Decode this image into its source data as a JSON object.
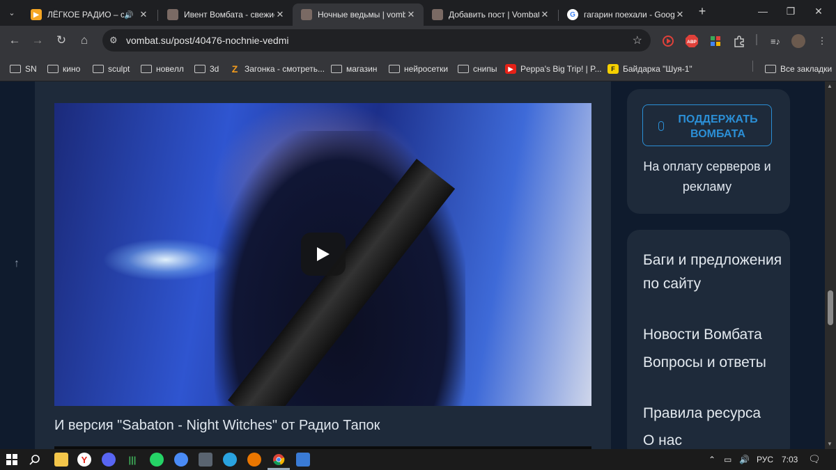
{
  "browser": {
    "tabs": [
      {
        "title": "ЛЁГКОЕ РАДИО – сл",
        "favicon": "play-triangle-orange",
        "audio": true,
        "active": false
      },
      {
        "title": "Ивент Вомбата - свежие",
        "favicon": "wombat",
        "active": false
      },
      {
        "title": "Ночные ведьмы | vombat",
        "favicon": "wombat",
        "active": true
      },
      {
        "title": "Добавить пост | Vombat",
        "favicon": "wombat",
        "active": false
      },
      {
        "title": "гагарин поехали - Goog",
        "favicon": "google-g",
        "active": false
      }
    ],
    "url": "vombat.su/post/40476-nochnie-vedmi",
    "extensions": [
      {
        "name": "record-icon",
        "color": "#e0413a"
      },
      {
        "name": "adblock-icon",
        "label": "ABP",
        "color": "#e0413a"
      },
      {
        "name": "puzzle-color-icon",
        "color": "#3aa858"
      },
      {
        "name": "extensions-icon",
        "color": "#c8c8c8"
      }
    ],
    "bookmarks": [
      {
        "label": "SN",
        "type": "folder"
      },
      {
        "label": "кино",
        "type": "folder"
      },
      {
        "label": "sculpt",
        "type": "folder"
      },
      {
        "label": "новелл",
        "type": "folder"
      },
      {
        "label": "3d",
        "type": "folder"
      },
      {
        "label": "Загонка - смотреть...",
        "type": "link",
        "icon": "Z",
        "color": "#f29b1d"
      },
      {
        "label": "магазин",
        "type": "folder"
      },
      {
        "label": "нейросетки",
        "type": "folder"
      },
      {
        "label": "снипы",
        "type": "folder"
      },
      {
        "label": "Peppa's Big Trip! | P...",
        "type": "link",
        "icon": "▶",
        "color": "#e62117"
      },
      {
        "label": "Байдарка \"Шуя-1\"",
        "type": "link",
        "icon": "F",
        "color": "#f5d000"
      }
    ],
    "all_bookmarks": "Все закладки"
  },
  "page": {
    "video": {
      "state": "paused"
    },
    "caption": "И версия \"Sabaton - Night Witches\" от Радио Тапок",
    "sidebar": {
      "support_button": "ПОДДЕРЖАТЬ ВОМБАТА",
      "support_text": "На оплату серверов и рекламу",
      "links": [
        "Баги и предложения по сайту",
        "Новости Вомбата",
        "Вопросы и ответы",
        "Правила ресурса",
        "О нас"
      ]
    }
  },
  "taskbar": {
    "apps": [
      {
        "name": "windows-start-icon"
      },
      {
        "name": "search-icon"
      },
      {
        "name": "file-explorer-icon"
      },
      {
        "name": "yandex-browser-icon"
      },
      {
        "name": "discord-icon"
      },
      {
        "name": "app-green-icon"
      },
      {
        "name": "whatsapp-icon"
      },
      {
        "name": "chromium-icon"
      },
      {
        "name": "calculator-icon"
      },
      {
        "name": "telegram-icon"
      },
      {
        "name": "blender-icon"
      },
      {
        "name": "chrome-icon"
      },
      {
        "name": "photos-icon"
      }
    ],
    "language": "РУС",
    "time": "7:03"
  },
  "colors": {
    "page_bg": "#0f1b2d",
    "card_bg": "#1e2a3a",
    "accent": "#2b8fd6"
  }
}
